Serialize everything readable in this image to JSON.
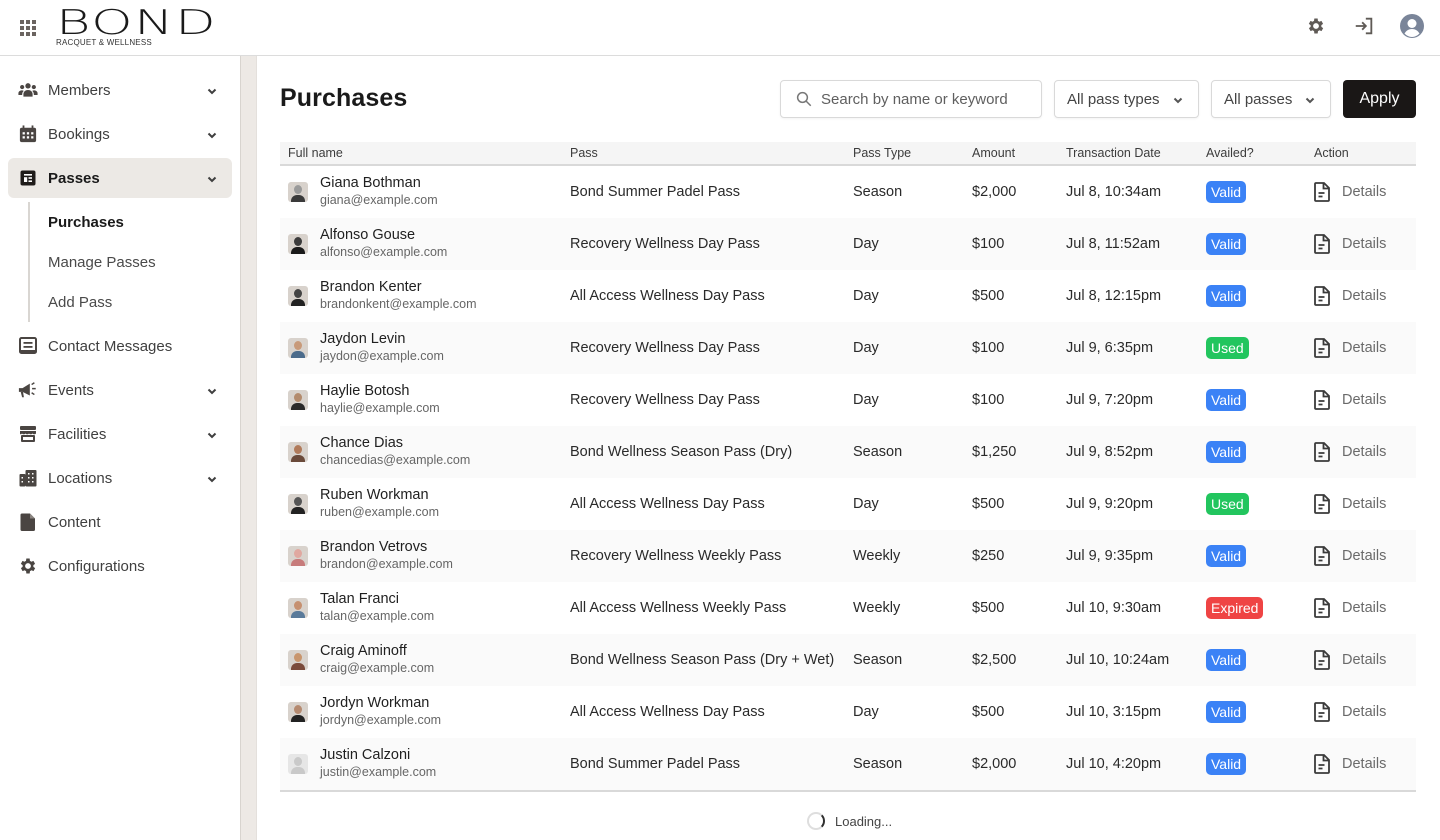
{
  "header": {
    "logo_word": "BOND",
    "logo_sub": "Racquet & Wellness",
    "icons": [
      "apps-grid-icon",
      "gear-icon",
      "sign-in-icon",
      "user-avatar-icon"
    ]
  },
  "sidebar": {
    "items": [
      {
        "label": "Members",
        "icon": "users-icon",
        "expandable": true
      },
      {
        "label": "Bookings",
        "icon": "calendar-icon",
        "expandable": true
      },
      {
        "label": "Passes",
        "icon": "pass-icon",
        "expandable": true,
        "active": true
      },
      {
        "label": "Contact Messages",
        "icon": "message-icon",
        "expandable": false
      },
      {
        "label": "Events",
        "icon": "megaphone-icon",
        "expandable": true
      },
      {
        "label": "Facilities",
        "icon": "store-icon",
        "expandable": true
      },
      {
        "label": "Locations",
        "icon": "building-icon",
        "expandable": true
      },
      {
        "label": "Content",
        "icon": "file-icon",
        "expandable": false
      },
      {
        "label": "Configurations",
        "icon": "gear-icon",
        "expandable": false
      }
    ],
    "passes_sub": [
      {
        "label": "Purchases",
        "active": true
      },
      {
        "label": "Manage Passes"
      },
      {
        "label": "Add Pass"
      }
    ]
  },
  "main": {
    "title": "Purchases",
    "search_placeholder": "Search by name or keyword",
    "filter_pass_types": "All pass types",
    "filter_passes": "All passes",
    "apply_label": "Apply",
    "loading_text": "Loading..."
  },
  "status_colors": {
    "Valid": "#3b82f6",
    "Used": "#22c55e",
    "Expired": "#ef4444"
  },
  "table": {
    "columns": [
      "Full name",
      "Pass",
      "Pass Type",
      "Amount",
      "Transaction Date",
      "Availed?",
      "Action"
    ],
    "action_label": "Details",
    "rows": [
      {
        "name": "Giana Bothman",
        "email": "giana@example.com",
        "pass": "Bond Summer Padel Pass",
        "type": "Season",
        "amount": "$2,000",
        "date": "Jul 8, 10:34am",
        "status": "Valid"
      },
      {
        "name": "Alfonso Gouse",
        "email": "alfonso@example.com",
        "pass": "Recovery Wellness Day Pass",
        "type": "Day",
        "amount": "$100",
        "date": "Jul 8, 11:52am",
        "status": "Valid"
      },
      {
        "name": "Brandon Kenter",
        "email": "brandonkent@example.com",
        "pass": "All Access Wellness Day Pass",
        "type": "Day",
        "amount": "$500",
        "date": "Jul 8, 12:15pm",
        "status": "Valid"
      },
      {
        "name": "Jaydon Levin",
        "email": "jaydon@example.com",
        "pass": "Recovery Wellness Day Pass",
        "type": "Day",
        "amount": "$100",
        "date": "Jul 9, 6:35pm",
        "status": "Used"
      },
      {
        "name": "Haylie Botosh",
        "email": "haylie@example.com",
        "pass": "Recovery Wellness Day Pass",
        "type": "Day",
        "amount": "$100",
        "date": "Jul 9, 7:20pm",
        "status": "Valid"
      },
      {
        "name": "Chance Dias",
        "email": "chancedias@example.com",
        "pass": "Bond Wellness Season Pass (Dry)",
        "type": "Season",
        "amount": "$1,250",
        "date": "Jul 9, 8:52pm",
        "status": "Valid"
      },
      {
        "name": "Ruben Workman",
        "email": "ruben@example.com",
        "pass": "All Access Wellness Day Pass",
        "type": "Day",
        "amount": "$500",
        "date": "Jul 9, 9:20pm",
        "status": "Used"
      },
      {
        "name": "Brandon Vetrovs",
        "email": "brandon@example.com",
        "pass": "Recovery Wellness Weekly Pass",
        "type": "Weekly",
        "amount": "$250",
        "date": "Jul 9, 9:35pm",
        "status": "Valid"
      },
      {
        "name": "Talan Franci",
        "email": "talan@example.com",
        "pass": "All Access Wellness Weekly Pass",
        "type": "Weekly",
        "amount": "$500",
        "date": "Jul 10, 9:30am",
        "status": "Expired"
      },
      {
        "name": "Craig Aminoff",
        "email": "craig@example.com",
        "pass": "Bond Wellness Season Pass (Dry + Wet)",
        "type": "Season",
        "amount": "$2,500",
        "date": "Jul 10, 10:24am",
        "status": "Valid"
      },
      {
        "name": "Jordyn Workman",
        "email": "jordyn@example.com",
        "pass": "All Access Wellness Day Pass",
        "type": "Day",
        "amount": "$500",
        "date": "Jul 10, 3:15pm",
        "status": "Valid"
      },
      {
        "name": "Justin Calzoni",
        "email": "justin@example.com",
        "pass": "Bond Summer Padel Pass",
        "type": "Season",
        "amount": "$2,000",
        "date": "Jul 10, 4:20pm",
        "status": "Valid",
        "placeholder_avatar": true
      }
    ]
  }
}
